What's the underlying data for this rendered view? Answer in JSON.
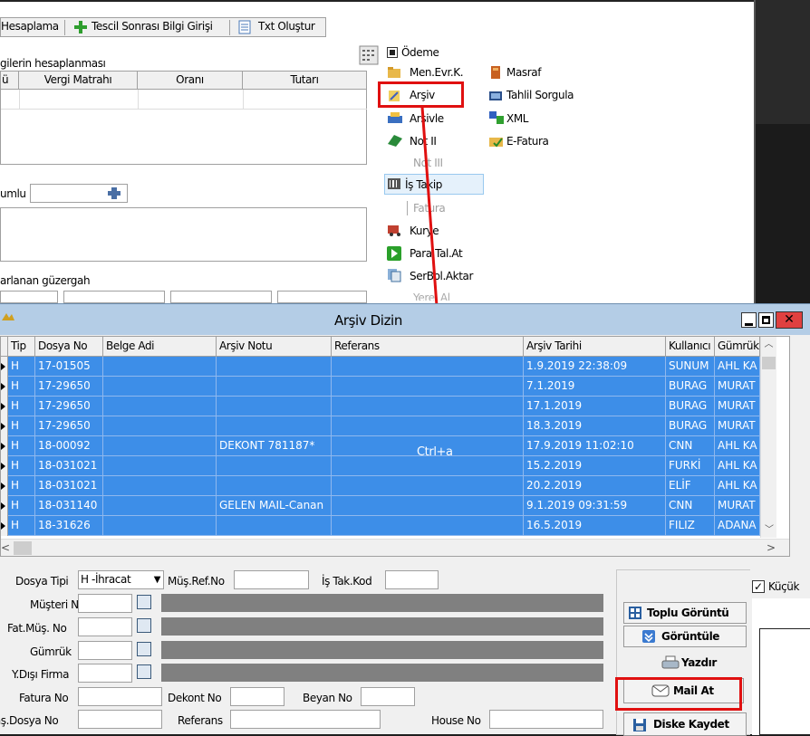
{
  "toolbar": {
    "items": [
      "Hesaplama",
      "Tescil Sonrası Bilgi Girişi",
      "Txt Oluştur"
    ]
  },
  "taxes": {
    "title": "gilerin hesaplanması",
    "cols": [
      "ü",
      "Vergi Matrahı",
      "Oranı",
      "Tutarı"
    ]
  },
  "left": {
    "umlu": "umlu",
    "route": "arlanan güzergah"
  },
  "menu": {
    "odeme": "Ödeme",
    "items_left": [
      "Men.Evr.K.",
      "Arşiv",
      "Arşivle",
      "Not II",
      "Not III",
      "İş Takip",
      "Fatura",
      "Kurye",
      "Para Tal.At",
      "SerBol.Aktar",
      "Yerel Al"
    ],
    "items_right": [
      "Masraf",
      "Tahlil Sorgula",
      "XML",
      "E-Fatura"
    ]
  },
  "dialog": {
    "title": "Arşiv Dizin",
    "overlay": "Ctrl+a",
    "columns": [
      "Tip",
      "Dosya No",
      "Belge Adi",
      "Arşiv Notu",
      "Referans",
      "Arşiv Tarihi",
      "Kullanıcı",
      "Gümrük"
    ],
    "rows": [
      [
        "H",
        "17-01505",
        "",
        "",
        "",
        "1.9.2019 22:38:09",
        "SUNUM",
        "AHL KA"
      ],
      [
        "H",
        "17-29650",
        "",
        "",
        "",
        "7.1.2019",
        "BURAG",
        "MURAT"
      ],
      [
        "H",
        "17-29650",
        "",
        "",
        "",
        "17.1.2019",
        "BURAG",
        "MURAT"
      ],
      [
        "H",
        "17-29650",
        "",
        "",
        "",
        "18.3.2019",
        "BURAG",
        "MURAT"
      ],
      [
        "H",
        "18-00092",
        "",
        "DEKONT 781187*",
        "",
        "17.9.2019 11:02:10",
        "CNN",
        "AHL KA"
      ],
      [
        "H",
        "18-031021",
        "",
        "",
        "",
        "15.2.2019",
        "FURKİ",
        "AHL KA"
      ],
      [
        "H",
        "18-031021",
        "",
        "",
        "",
        "20.2.2019",
        "ELİF",
        "AHL KA"
      ],
      [
        "H",
        "18-031140",
        "",
        "GELEN MAIL-Canan",
        "",
        "9.1.2019 09:31:59",
        "CNN",
        "MURAT"
      ],
      [
        "H",
        "18-31626",
        "",
        "",
        "",
        "16.5.2019",
        "FILIZ",
        "ADANA"
      ]
    ],
    "form": {
      "dosya_tipi_label": "Dosya Tipi",
      "dosya_tipi_value": "H -İhracat",
      "mus_ref_label": "Müş.Ref.No",
      "is_tak_label": "İş Tak.Kod",
      "musteri_label": "Müşteri No",
      "fat_mus_label": "Fat.Müş. No",
      "gumruk_label": "Gümrük",
      "ydisi_label": "Y.Dışı Firma",
      "fatura_label": "Fatura No",
      "dekont_label": "Dekont No",
      "beyan_label": "Beyan No",
      "bas_dosya_label": "Baş.Dosya No",
      "referans_label": "Referans",
      "house_label": "House No"
    },
    "buttons": {
      "toplu": "Toplu Görüntü",
      "goruntule": "Görüntüle",
      "yazdir": "Yazdır",
      "mail": "Mail At",
      "disk": "Diske Kaydet"
    },
    "kucuk": "Küçük"
  },
  "colors": {
    "selection": "#3d8ee8",
    "highlight": "#e01010",
    "titlebar": "#b4cde6"
  }
}
